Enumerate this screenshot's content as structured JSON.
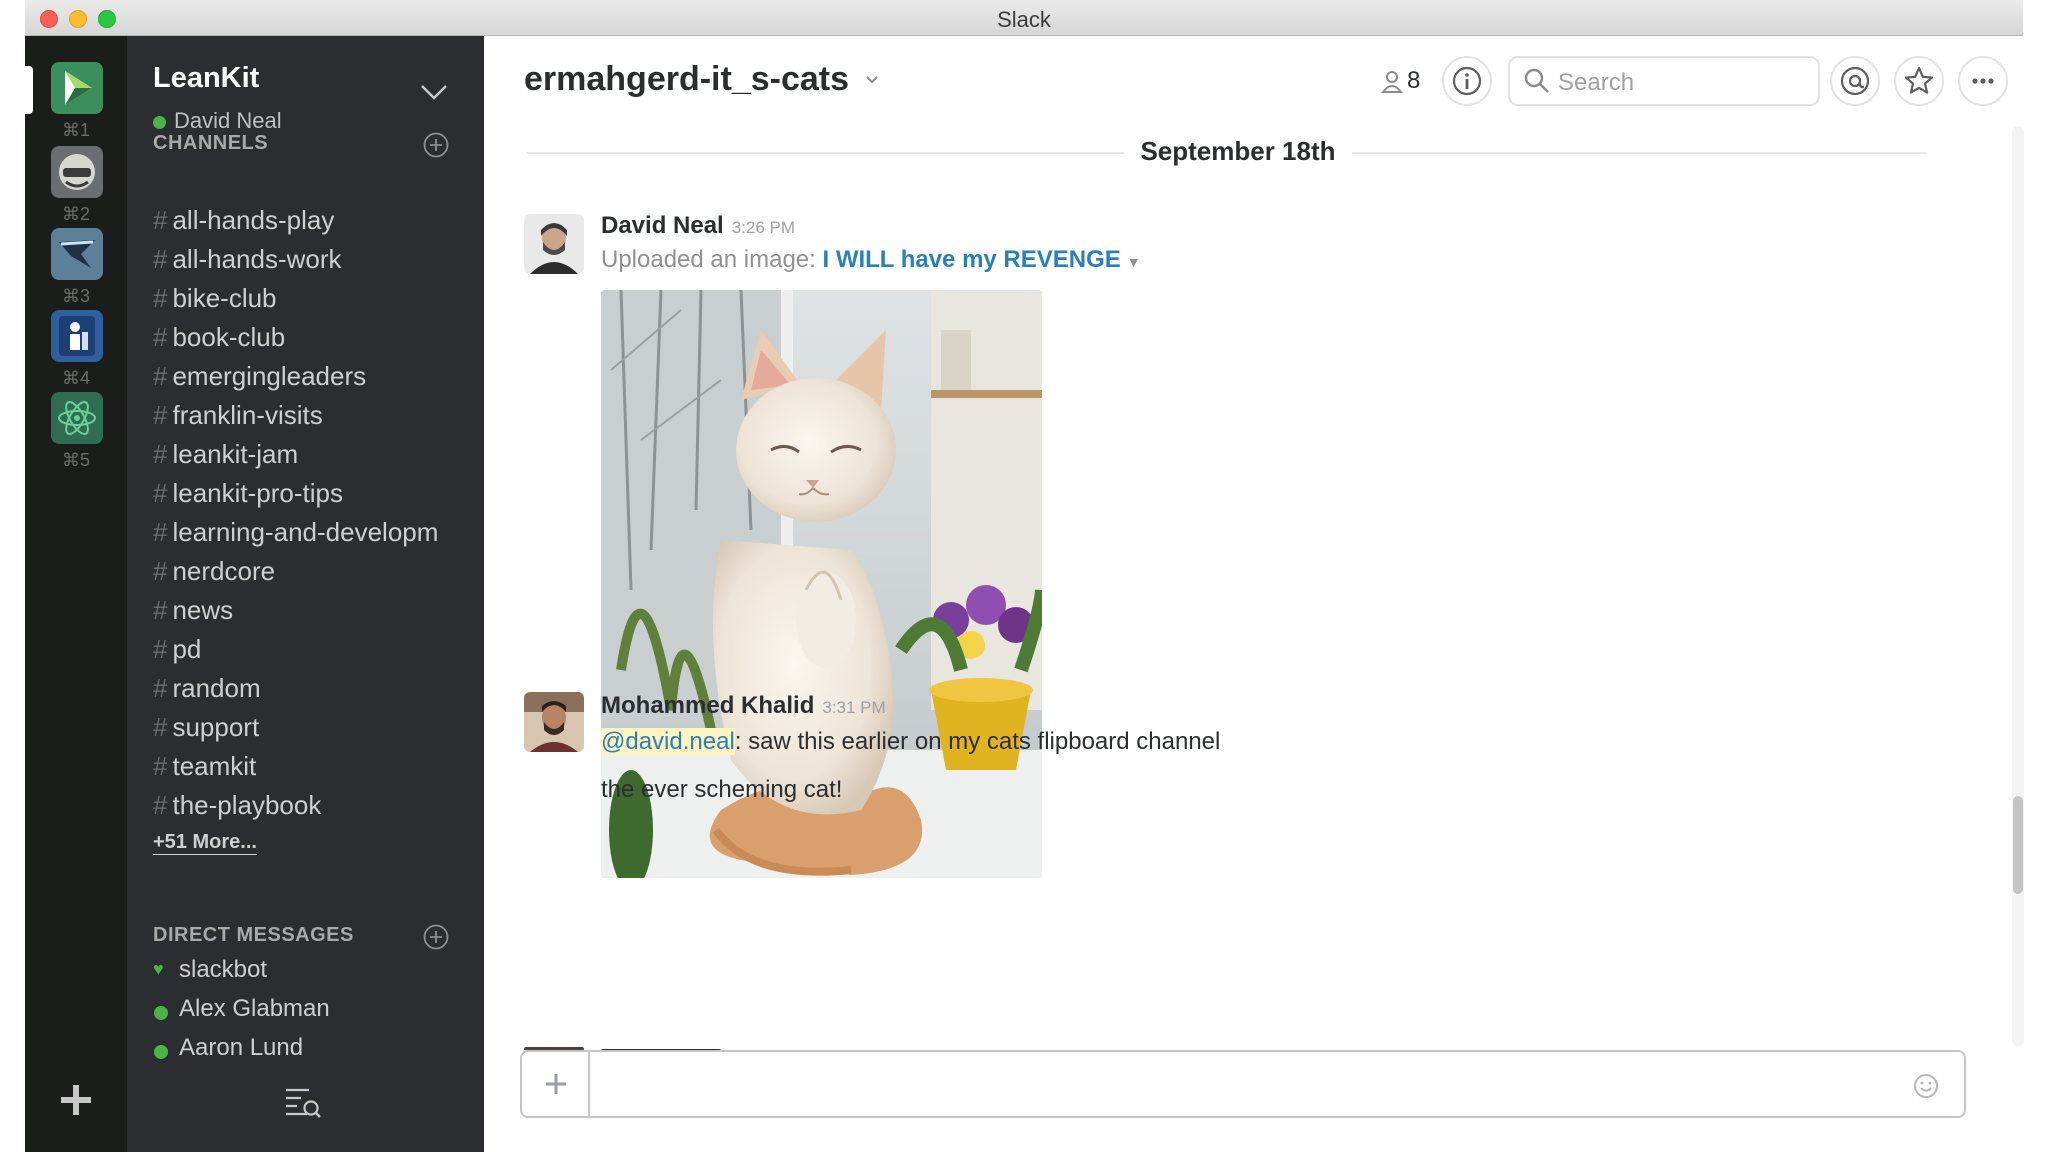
{
  "window": {
    "title": "Slack"
  },
  "teams": [
    {
      "shortcut": "⌘1",
      "icon": "leankit-logo-icon",
      "color": "#2a7a4b"
    },
    {
      "shortcut": "⌘2",
      "icon": "team-mascot-icon",
      "color": "#5a5e60"
    },
    {
      "shortcut": "⌘3",
      "icon": "team-flag-icon",
      "color": "#4a6e8a"
    },
    {
      "shortcut": "⌘4",
      "icon": "team-figure-icon",
      "color": "#2f5f9e"
    },
    {
      "shortcut": "⌘5",
      "icon": "atom-icon",
      "color": "#2f7a5a"
    }
  ],
  "sidebar": {
    "team_name": "LeanKit",
    "user_name": "David Neal",
    "channels_title": "CHANNELS",
    "channels": [
      "all-hands-play",
      "all-hands-work",
      "bike-club",
      "book-club",
      "emergingleaders",
      "franklin-visits",
      "leankit-jam",
      "leankit-pro-tips",
      "learning-and-developm",
      "nerdcore",
      "news",
      "pd",
      "random",
      "support",
      "teamkit",
      "the-playbook"
    ],
    "more_label": "+51 More...",
    "dm_title": "DIRECT MESSAGES",
    "dms": [
      "slackbot",
      "Alex Glabman",
      "Aaron Lund"
    ]
  },
  "header": {
    "channel_name": "ermahgerd-it_s-cats",
    "member_count": "8",
    "search_placeholder": "Search"
  },
  "messages": {
    "date_label": "September 18th",
    "m1": {
      "author": "David Neal",
      "time": "3:26 PM",
      "prefix": "Uploaded an image: ",
      "link": "I WILL have my REVENGE"
    },
    "m2": {
      "author": "Mohammed Khalid",
      "time": "3:31 PM",
      "mention": "@david.neal",
      "text": ": saw this earlier on my cats flipboard channel",
      "text2": "the ever scheming cat!"
    }
  },
  "colors": {
    "sidebar_bg": "#2c2d30",
    "rail_bg": "#1b1d1b",
    "link": "#2a80b9",
    "presence": "#4bb543"
  }
}
